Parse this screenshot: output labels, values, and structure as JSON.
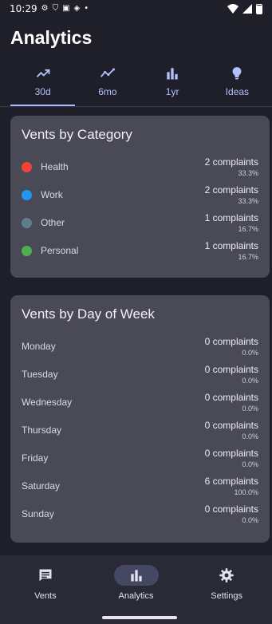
{
  "status_bar": {
    "time": "10:29"
  },
  "page": {
    "title": "Analytics"
  },
  "tabs": [
    {
      "label": "30d",
      "icon": "trending-up-icon",
      "active": true
    },
    {
      "label": "6mo",
      "icon": "timeline-icon",
      "active": false
    },
    {
      "label": "1yr",
      "icon": "bar-chart-icon",
      "active": false
    },
    {
      "label": "Ideas",
      "icon": "lightbulb-icon",
      "active": false
    }
  ],
  "category_card": {
    "title": "Vents by Category",
    "rows": [
      {
        "label": "Health",
        "count": "2 complaints",
        "percent": "33.3%",
        "color": "#f44336"
      },
      {
        "label": "Work",
        "count": "2 complaints",
        "percent": "33.3%",
        "color": "#2196f3"
      },
      {
        "label": "Other",
        "count": "1 complaints",
        "percent": "16.7%",
        "color": "#607d8b"
      },
      {
        "label": "Personal",
        "count": "1 complaints",
        "percent": "16.7%",
        "color": "#4caf50"
      }
    ]
  },
  "day_card": {
    "title": "Vents by Day of Week",
    "rows": [
      {
        "label": "Monday",
        "count": "0 complaints",
        "percent": "0.0%"
      },
      {
        "label": "Tuesday",
        "count": "0 complaints",
        "percent": "0.0%"
      },
      {
        "label": "Wednesday",
        "count": "0 complaints",
        "percent": "0.0%"
      },
      {
        "label": "Thursday",
        "count": "0 complaints",
        "percent": "0.0%"
      },
      {
        "label": "Friday",
        "count": "0 complaints",
        "percent": "0.0%"
      },
      {
        "label": "Saturday",
        "count": "6 complaints",
        "percent": "100.0%"
      },
      {
        "label": "Sunday",
        "count": "0 complaints",
        "percent": "0.0%"
      }
    ]
  },
  "bottom_nav": [
    {
      "label": "Vents",
      "icon": "chat-icon",
      "active": false
    },
    {
      "label": "Analytics",
      "icon": "bar-chart-icon",
      "active": true
    },
    {
      "label": "Settings",
      "icon": "gear-icon",
      "active": false
    }
  ],
  "colors": {
    "background": "#1e1f28",
    "card": "#494a56",
    "accent": "#b3c0ff",
    "nav_background": "#292a35"
  }
}
